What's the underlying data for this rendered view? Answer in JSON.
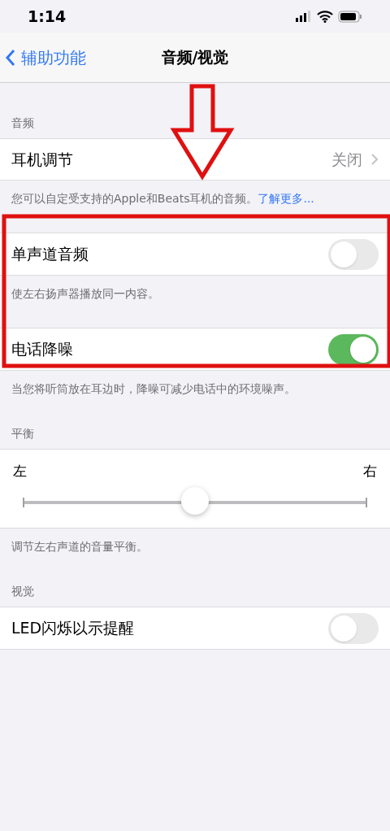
{
  "status_bar": {
    "time": "1:14"
  },
  "nav": {
    "back": "辅助功能",
    "title": "音频/视觉"
  },
  "sections": [
    {
      "header": "音频",
      "rows": [
        {
          "kind": "link",
          "label": "耳机调节",
          "value": "关闭"
        }
      ],
      "footer": "您可以自定受支持的Apple和Beats耳机的音频。",
      "footer_link": "了解更多..."
    },
    {
      "rows": [
        {
          "kind": "toggle",
          "label": "单声道音频",
          "on": false
        }
      ],
      "footer": "使左右扬声器播放同一内容。"
    },
    {
      "rows": [
        {
          "kind": "toggle",
          "label": "电话降噪",
          "on": true
        }
      ],
      "footer": "当您将听筒放在耳边时，降噪可减少电话中的环境噪声。"
    },
    {
      "header": "平衡",
      "rows": [
        {
          "kind": "slider",
          "left": "左",
          "right": "右",
          "level": 0.5
        }
      ],
      "footer": "调节左右声道的音量平衡。"
    },
    {
      "header": "视觉",
      "rows": [
        {
          "kind": "toggle",
          "label": "LED闪烁以示提醒",
          "on": false
        }
      ]
    }
  ]
}
